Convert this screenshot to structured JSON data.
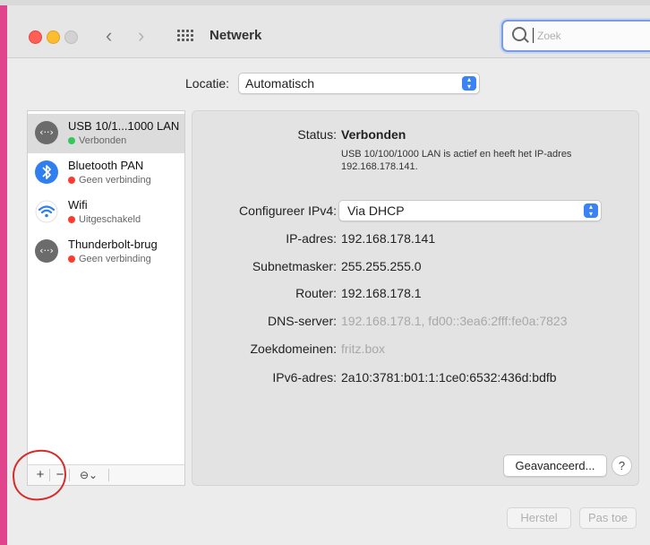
{
  "window": {
    "title": "Netwerk"
  },
  "search": {
    "placeholder": "Zoek"
  },
  "location": {
    "label": "Locatie:",
    "value": "Automatisch"
  },
  "services": [
    {
      "name": "USB 10/1...1000 LAN",
      "status": "Verbonden",
      "status_color": "#34c759",
      "icon": "ethernet-icon"
    },
    {
      "name": "Bluetooth PAN",
      "status": "Geen verbinding",
      "status_color": "#ff3b30",
      "icon": "bluetooth-icon"
    },
    {
      "name": "Wifi",
      "status": "Uitgeschakeld",
      "status_color": "#ff3b30",
      "icon": "wifi-icon"
    },
    {
      "name": "Thunderbolt-brug",
      "status": "Geen verbinding",
      "status_color": "#ff3b30",
      "icon": "ethernet-icon"
    }
  ],
  "toolbar": {
    "add": "+",
    "remove": "−",
    "more": "⊖⌄"
  },
  "detail": {
    "status_label": "Status:",
    "status_value": "Verbonden",
    "status_desc": "USB 10/100/1000 LAN is actief en heeft het IP-adres 192.168.178.141.",
    "configure_label": "Configureer IPv4:",
    "configure_value": "Via DHCP",
    "ip_label": "IP-adres:",
    "ip_value": "192.168.178.141",
    "subnet_label": "Subnetmasker:",
    "subnet_value": "255.255.255.0",
    "router_label": "Router:",
    "router_value": "192.168.178.1",
    "dns_label": "DNS-server:",
    "dns_value": "192.168.178.1, fd00::3ea6:2fff:fe0a:7823",
    "search_domains_label": "Zoekdomeinen:",
    "search_domains_value": "fritz.box",
    "ipv6_label": "IPv6-adres:",
    "ipv6_value": "2a10:3781:b01:1:1ce0:6532:436d:bdfb"
  },
  "buttons": {
    "advanced": "Geavanceerd...",
    "help": "?",
    "revert": "Herstel",
    "apply": "Pas toe"
  },
  "colors": {
    "accent": "#3b82f6",
    "connected": "#34c759",
    "disconnected": "#ff3b30",
    "annotation": "#d62b2b"
  }
}
